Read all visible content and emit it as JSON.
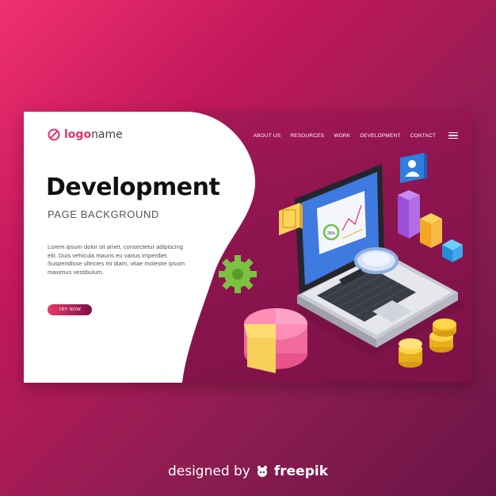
{
  "brand": {
    "logo_bold": "logo",
    "logo_regular": "name",
    "accent": "#e0306a"
  },
  "nav": {
    "items": [
      "ABOUT US",
      "RESOURCES",
      "WORK",
      "DEVELOPMENT",
      "CONTACT"
    ],
    "menu_icon": "hamburger-icon"
  },
  "hero": {
    "title": "Development",
    "subtitle": "PAGE BACKGROUND",
    "body": "Lorem ipsum dolor sit amet, consectetur adipiscing elit. Duis vehicula mauris eu varius imperdiet. Suspendisse ultricies mi diam, vitae molestie ipsum maximus vestibulum.",
    "cta": "TRY NOW"
  },
  "illustration": {
    "screen_badge": "25%",
    "icons": [
      "laptop-icon",
      "magnifier-icon",
      "gear-icon",
      "pie-chart-icon",
      "bar-chart-icon",
      "coins-icon",
      "user-icon",
      "image-icon"
    ]
  },
  "footer": {
    "designed_by": "designed by",
    "brand": "freepik"
  }
}
